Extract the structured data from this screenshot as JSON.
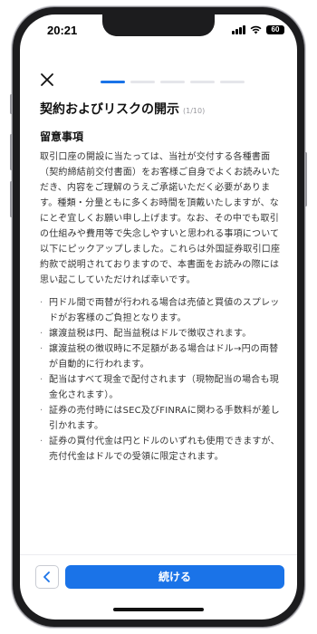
{
  "status": {
    "time": "20:21",
    "battery": "60"
  },
  "colors": {
    "accent": "#1a73e8",
    "progress_inactive": "#e5e6ea"
  },
  "progress": {
    "total_segments": 5,
    "active_segment": 1
  },
  "page": {
    "title": "契約およびリスクの開示",
    "step": "(1/10)",
    "section_heading": "留意事項",
    "intro": "取引口座の開設に当たっては、当社が交付する各種書面（契約締結前交付書面）をお客様ご自身でよくお読みいただき、内容をご理解のうえご承諾いただく必要があります。種類・分量ともに多くお時間を頂戴いたしますが、なにとぞ宜しくお願い申し上げます。なお、その中でも取引の仕組みや費用等で失念しやすいと思われる事項について以下にピックアップしました。これらは外国証券取引口座約款で説明されておりますので、本書面をお読みの際には思い起こしていただければ幸いです。",
    "notes": [
      "円ドル間で両替が行われる場合は売値と買値のスプレッドがお客様のご負担となります。",
      "譲渡益税は円、配当益税はドルで徴収されます。",
      "譲渡益税の徴収時に不足額がある場合はドル→円の両替が自動的に行われます。",
      "配当はすべて現金で配付されます（現物配当の場合も現金化されます）。",
      "証券の売付時にはSEC及びFINRAに関わる手数料が差し引かれます。",
      "証券の買付代金は円とドルのいずれも使用できますが、売付代金はドルでの受領に限定されます。"
    ]
  },
  "footer": {
    "continue_label": "続ける"
  },
  "icons": {
    "close": "close-icon",
    "back": "chevron-left-icon"
  }
}
